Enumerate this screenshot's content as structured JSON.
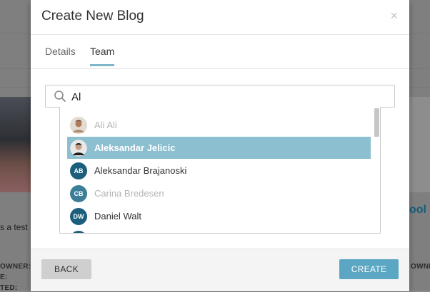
{
  "background": {
    "left_text": "s a test",
    "right_title": "ool v",
    "owner_label_left": "OWNER:",
    "type_label_left": "E:",
    "ted_label_left": "TED:",
    "owner_label_right": "OWNER:"
  },
  "modal": {
    "title": "Create New Blog",
    "close_glyph": "×",
    "tabs": [
      {
        "label": "Details",
        "active": false
      },
      {
        "label": "Team",
        "active": true
      }
    ],
    "search": {
      "value": "Al",
      "placeholder": ""
    },
    "options": [
      {
        "name": "Ali Ali",
        "initials": "",
        "avatar": "photo-ali",
        "state": "disabled"
      },
      {
        "name": "Aleksandar Jelicic",
        "initials": "",
        "avatar": "photo-aleksandar",
        "state": "selected"
      },
      {
        "name": "Aleksandar Brajanoski",
        "initials": "AB",
        "avatar": "initials",
        "state": "normal"
      },
      {
        "name": "Carina Bredesen",
        "initials": "CB",
        "avatar": "initials",
        "state": "disabled"
      },
      {
        "name": "Daniel Walt",
        "initials": "DW",
        "avatar": "initials",
        "state": "normal"
      }
    ],
    "buttons": {
      "back": "BACK",
      "create": "CREATE"
    }
  },
  "colors": {
    "accent": "#5aa6c3",
    "selected_row": "#8cbfd0",
    "avatar_bg": "#1b5f7c",
    "tab_underline": "#7fb6c8"
  }
}
